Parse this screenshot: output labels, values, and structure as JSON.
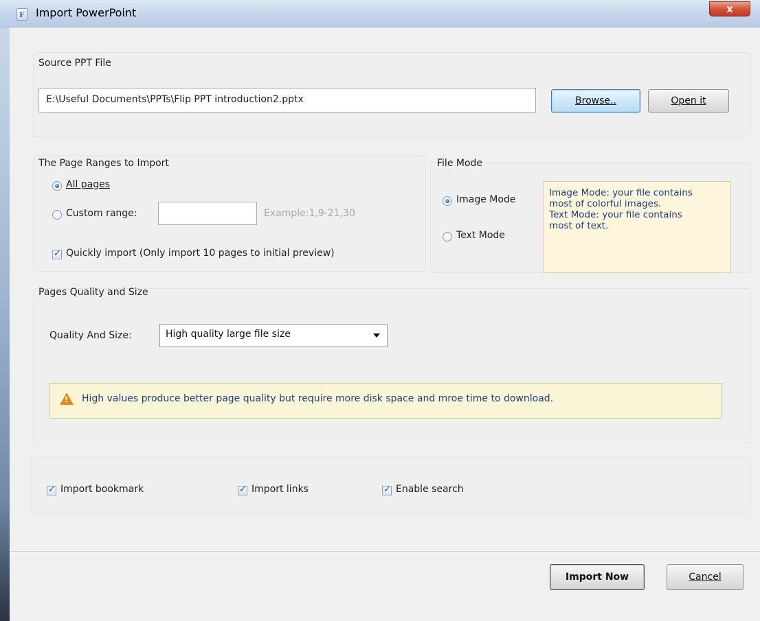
{
  "window": {
    "title": "Import PowerPoint",
    "close_glyph": "x",
    "app_icon_glyph": "F"
  },
  "source": {
    "section_label": "Source PPT File",
    "file_path": "E:\\Useful Documents\\PPTs\\Flip PPT introduction2.pptx",
    "browse_label": "Browse..",
    "open_label": "Open it"
  },
  "page_ranges": {
    "section_label": "The Page Ranges to Import",
    "all_pages_label": "All pages",
    "all_pages_checked": true,
    "custom_range_label": "Custom range:",
    "custom_range_value": "",
    "example_text": "Example:1,9-21,30",
    "quick_import_label": "Quickly import (Only import 10 pages to  initial  preview)",
    "quick_import_checked": true
  },
  "file_mode": {
    "section_label": "File Mode",
    "image_mode_label": "Image Mode",
    "text_mode_label": "Text Mode",
    "selected": "Image Mode",
    "info_line1": "Image Mode: your file contains",
    "info_line2": "most of colorful images.",
    "info_line3": "Text Mode: your file contains",
    "info_line4": "most of text."
  },
  "quality": {
    "section_label": "Pages Quality and Size",
    "field_label": "Quality And Size:",
    "selected_value": "High quality large file size",
    "warning_text": "High values produce better page quality but require more disk space and mroe time to download.",
    "warning_glyph": "!"
  },
  "options": {
    "import_bookmark_label": "Import bookmark",
    "import_links_label": "Import links",
    "enable_search_label": "Enable search"
  },
  "actions": {
    "import_now_label": "Import Now",
    "cancel_label": "Cancel"
  },
  "colors": {
    "accent": "#3c7fb1",
    "info_text": "#1f3f7a",
    "info_bg": "#fdf6dc",
    "warn_icon": "#e38a1c",
    "close_button": "#c13a22"
  },
  "icons": {
    "app": "app-icon",
    "close": "close-icon",
    "warning": "warning-icon",
    "dropdown": "chevron-down-icon"
  }
}
